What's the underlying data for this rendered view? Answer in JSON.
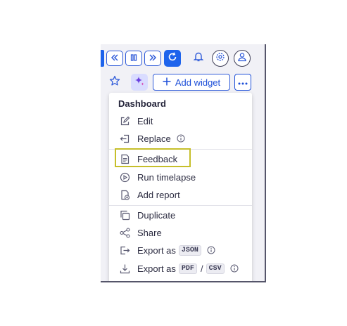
{
  "toolbar": {
    "add_widget_label": "Add widget"
  },
  "menu": {
    "title": "Dashboard",
    "items": [
      {
        "label": "Edit",
        "icon": "edit-icon"
      },
      {
        "label": "Replace",
        "icon": "replace-icon",
        "info": true
      },
      {
        "label": "Feedback",
        "icon": "feedback-icon",
        "highlighted": true
      },
      {
        "label": "Run timelapse",
        "icon": "play-icon"
      },
      {
        "label": "Add report",
        "icon": "report-icon"
      },
      {
        "label": "Duplicate",
        "icon": "duplicate-icon"
      },
      {
        "label": "Share",
        "icon": "share-icon"
      },
      {
        "label": "Export as",
        "icon": "export-icon",
        "badges": [
          "JSON"
        ],
        "info": true
      },
      {
        "label": "Export as",
        "icon": "download-icon",
        "badges": [
          "PDF",
          "CSV"
        ],
        "separator": "/",
        "info": true
      }
    ]
  },
  "colors": {
    "accent": "#1d63ec",
    "highlight_border": "#c6bf2a",
    "magic_bg": "#d9dcff"
  }
}
